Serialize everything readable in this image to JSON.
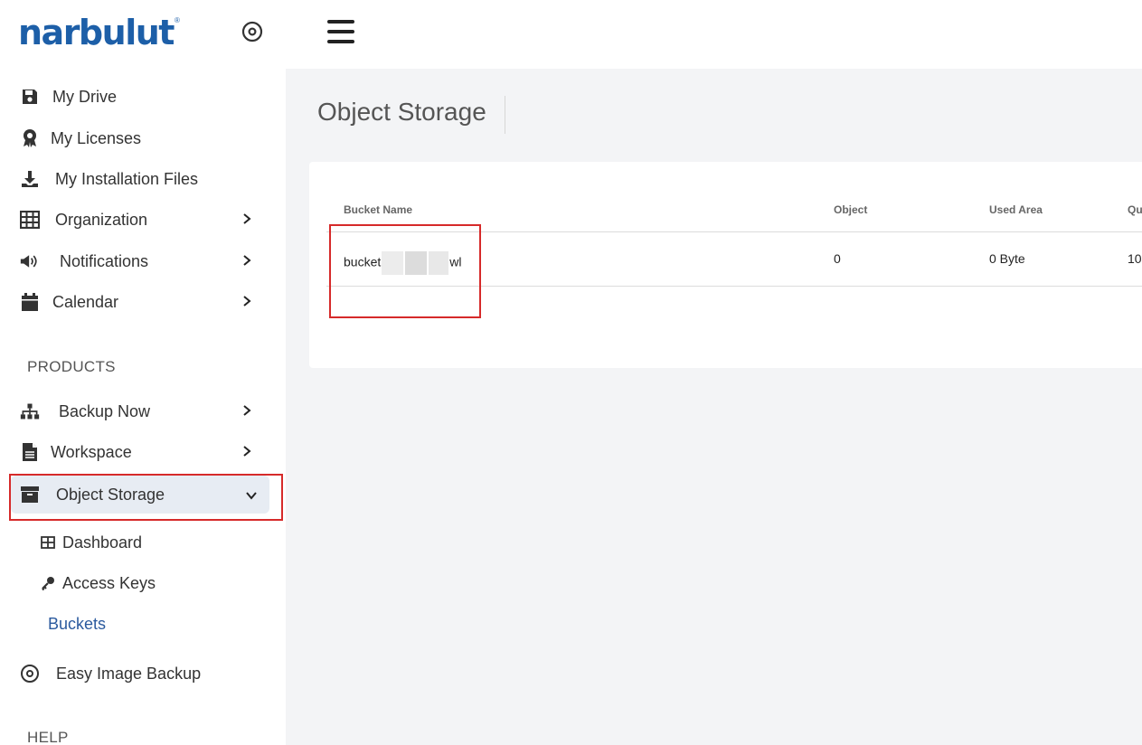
{
  "brand": {
    "logo_text": "narbulut",
    "logo_mark": "®"
  },
  "sidebar": {
    "items": [
      {
        "label": "My Drive",
        "icon": "floppy-disk-icon"
      },
      {
        "label": "My Licenses",
        "icon": "award-icon"
      },
      {
        "label": "My Installation Files",
        "icon": "download-icon"
      },
      {
        "label": "Organization",
        "icon": "grid-icon",
        "has_submenu": true
      },
      {
        "label": "Notifications",
        "icon": "speaker-icon",
        "has_submenu": true
      },
      {
        "label": "Calendar",
        "icon": "calendar-icon",
        "has_submenu": true
      }
    ],
    "products_title": "PRODUCTS",
    "products": [
      {
        "label": "Backup Now",
        "icon": "sitemap-icon",
        "has_submenu": true
      },
      {
        "label": "Workspace",
        "icon": "document-icon",
        "has_submenu": true
      },
      {
        "label": "Object Storage",
        "icon": "archive-box-icon",
        "expanded": true
      }
    ],
    "object_storage_sub": [
      {
        "label": "Dashboard",
        "icon": "table-icon"
      },
      {
        "label": "Access Keys",
        "icon": "key-icon"
      },
      {
        "label": "Buckets",
        "current": true
      }
    ],
    "easy_image_backup": {
      "label": "Easy Image Backup",
      "icon": "disc-icon"
    },
    "help_title": "HELP"
  },
  "page": {
    "title": "Object Storage"
  },
  "table": {
    "columns": [
      "Bucket Name",
      "Object",
      "Used Area",
      "Qu"
    ],
    "rows": [
      {
        "bucket_prefix": "bucket",
        "bucket_suffix": "wl",
        "object": "0",
        "used_area": "0 Byte",
        "quota": "10"
      }
    ]
  },
  "colors": {
    "brand": "#1d5fa8",
    "active_link": "#2b5a9e",
    "highlight": "#d62a2a",
    "active_bg": "#e7ecf3"
  }
}
